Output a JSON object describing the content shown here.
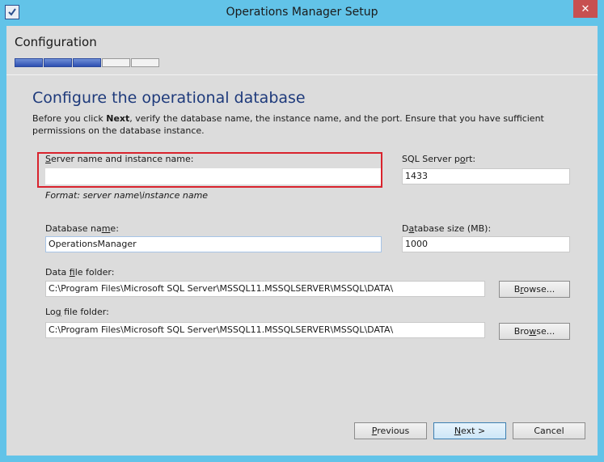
{
  "window": {
    "title": "Operations Manager Setup",
    "close_glyph": "✕",
    "app_icon": "setup-check-icon"
  },
  "header": {
    "title": "Configuration",
    "progress": {
      "total_steps": 5,
      "completed_steps": 3
    }
  },
  "page": {
    "heading": "Configure the operational database",
    "instructions_pre": "Before you click ",
    "instructions_bold": "Next",
    "instructions_post": ", verify the database name, the instance name, and the port. Ensure that you have sufficient permissions on the database instance."
  },
  "form": {
    "server_name": {
      "label_key": "S",
      "label_rest": "erver name and instance name:",
      "value": "",
      "format_hint": "Format: server name\\instance name"
    },
    "sql_port": {
      "label_pre": "SQL Server p",
      "label_key": "o",
      "label_post": "rt:",
      "value": "1433"
    },
    "database_name": {
      "label_pre": "Database na",
      "label_key": "m",
      "label_post": "e:",
      "value": "OperationsManager"
    },
    "database_size": {
      "label_pre": "D",
      "label_key": "a",
      "label_post": "tabase size (MB):",
      "value": "1000"
    },
    "data_folder": {
      "label_pre": "Data ",
      "label_key": "f",
      "label_post": "ile folder:",
      "value": "C:\\Program Files\\Microsoft SQL Server\\MSSQL11.MSSQLSERVER\\MSSQL\\DATA\\"
    },
    "log_folder": {
      "label_pre": "Lo",
      "label_key": "g",
      "label_post": " file folder:",
      "value": "C:\\Program Files\\Microsoft SQL Server\\MSSQL11.MSSQLSERVER\\MSSQL\\DATA\\"
    },
    "browse1": {
      "label_pre": "B",
      "label_key": "r",
      "label_post": "owse..."
    },
    "browse2": {
      "label_pre": "Bro",
      "label_key": "w",
      "label_post": "se..."
    }
  },
  "footer": {
    "previous": {
      "label_key": "P",
      "label_rest": "revious"
    },
    "next": {
      "label_key": "N",
      "label_rest": "ext >"
    },
    "cancel": {
      "label": "Cancel"
    }
  },
  "colors": {
    "title_bar": "#62c3e8",
    "heading": "#1e3a7b",
    "highlight": "#d9232d",
    "close": "#c75050"
  }
}
